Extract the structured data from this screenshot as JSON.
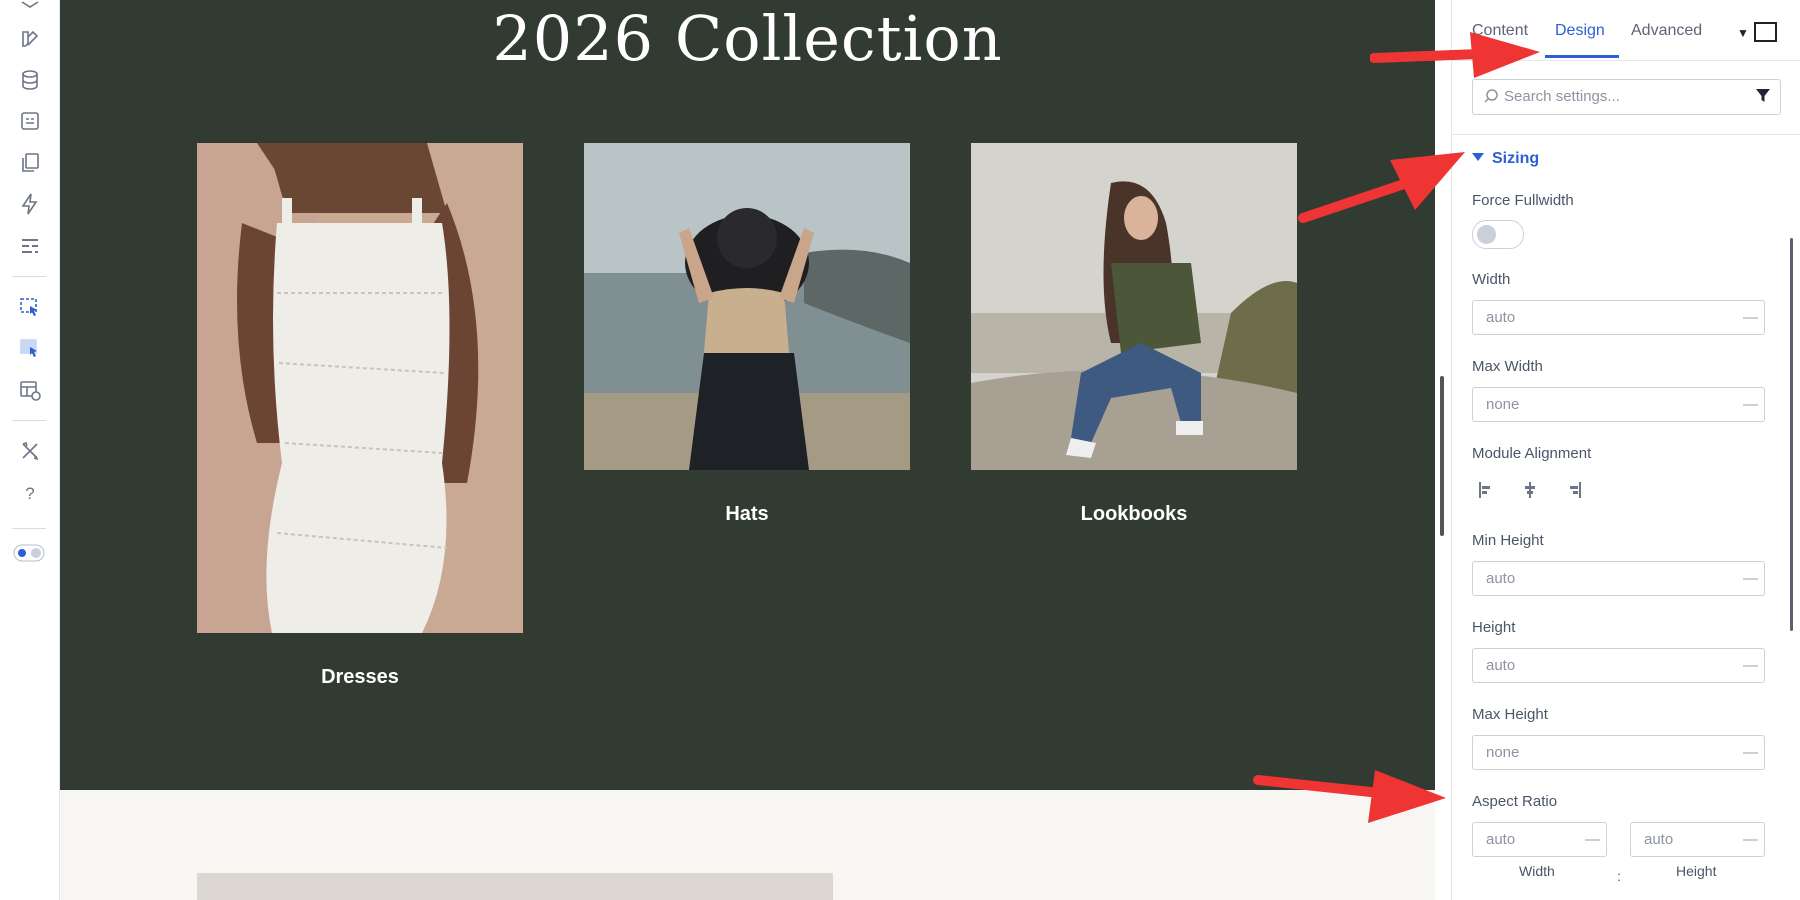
{
  "page": {
    "title": "2026 Collection"
  },
  "collection": [
    {
      "label": "Dresses",
      "image": "woman-white-dress-photo"
    },
    {
      "label": "Hats",
      "image": "woman-black-hat-photo"
    },
    {
      "label": "Lookbooks",
      "image": "woman-sitting-rock-photo"
    }
  ],
  "tabs": [
    {
      "label": "Content",
      "active": false
    },
    {
      "label": "Design",
      "active": true
    },
    {
      "label": "Advanced",
      "active": false
    }
  ],
  "search": {
    "placeholder": "Search settings..."
  },
  "section": {
    "title": "Sizing",
    "expanded": true
  },
  "fields": {
    "force_fullwidth": {
      "label": "Force Fullwidth",
      "on": false
    },
    "width": {
      "label": "Width",
      "value": "auto"
    },
    "max_width": {
      "label": "Max Width",
      "value": "none"
    },
    "module_alignment": {
      "label": "Module Alignment",
      "options": [
        "align-left-icon",
        "align-center-icon",
        "align-right-icon"
      ]
    },
    "min_height": {
      "label": "Min Height",
      "value": "auto"
    },
    "height": {
      "label": "Height",
      "value": "auto"
    },
    "max_height": {
      "label": "Max Height",
      "value": "none"
    },
    "aspect_ratio": {
      "label": "Aspect Ratio",
      "width_value": "auto",
      "height_value": "auto",
      "width_label": "Width",
      "height_label": "Height",
      "separator": ":"
    }
  },
  "sidebar_icons": [
    "layers-icon",
    "design-icon",
    "database-icon",
    "form-icon",
    "pages-icon",
    "lightning-icon",
    "layout-icon",
    "builder-icon",
    "builder-active-icon",
    "template-icon",
    "tools-icon",
    "help-icon",
    "theme-toggle-icon"
  ],
  "colors": {
    "accent": "#2c5fd4",
    "hero_bg": "#313b32",
    "annotation": "#ef3434"
  }
}
